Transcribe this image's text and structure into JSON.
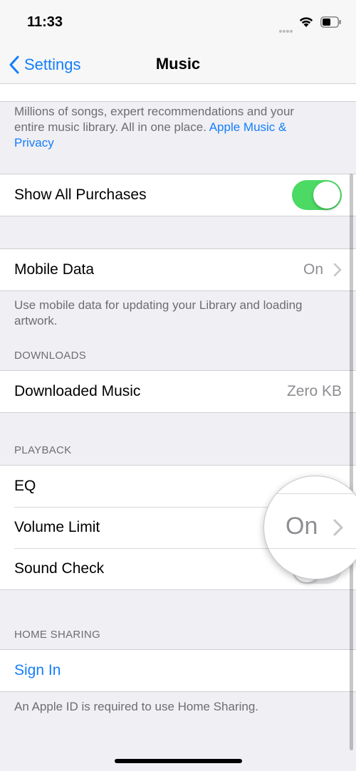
{
  "status_bar": {
    "time": "11:33"
  },
  "nav": {
    "back_label": "Settings",
    "title": "Music"
  },
  "apple_music_footer": {
    "text": "Millions of songs, expert recommendations and your entire music library. All in one place. ",
    "link": "Apple Music & Privacy"
  },
  "show_all_purchases": {
    "label": "Show All Purchases",
    "toggle_on": true
  },
  "mobile_data": {
    "label": "Mobile Data",
    "value": "On",
    "footer": "Use mobile data for updating your Library and loading artwork."
  },
  "downloads": {
    "header": "DOWNLOADS",
    "downloaded_music_label": "Downloaded Music",
    "downloaded_music_value": "Zero KB"
  },
  "playback": {
    "header": "PLAYBACK",
    "eq_label": "EQ",
    "volume_limit_label": "Volume Limit",
    "volume_limit_value": "On",
    "sound_check_label": "Sound Check",
    "sound_check_on": false
  },
  "home_sharing": {
    "header": "HOME SHARING",
    "sign_in_label": "Sign In",
    "footer": "An Apple ID is required to use Home Sharing."
  },
  "colors": {
    "accent": "#157efb",
    "toggle_on": "#4cd964",
    "background": "#efeff4"
  },
  "icons": [
    "wifi-icon",
    "battery-icon",
    "chevron-left-icon",
    "chevron-right-icon"
  ]
}
